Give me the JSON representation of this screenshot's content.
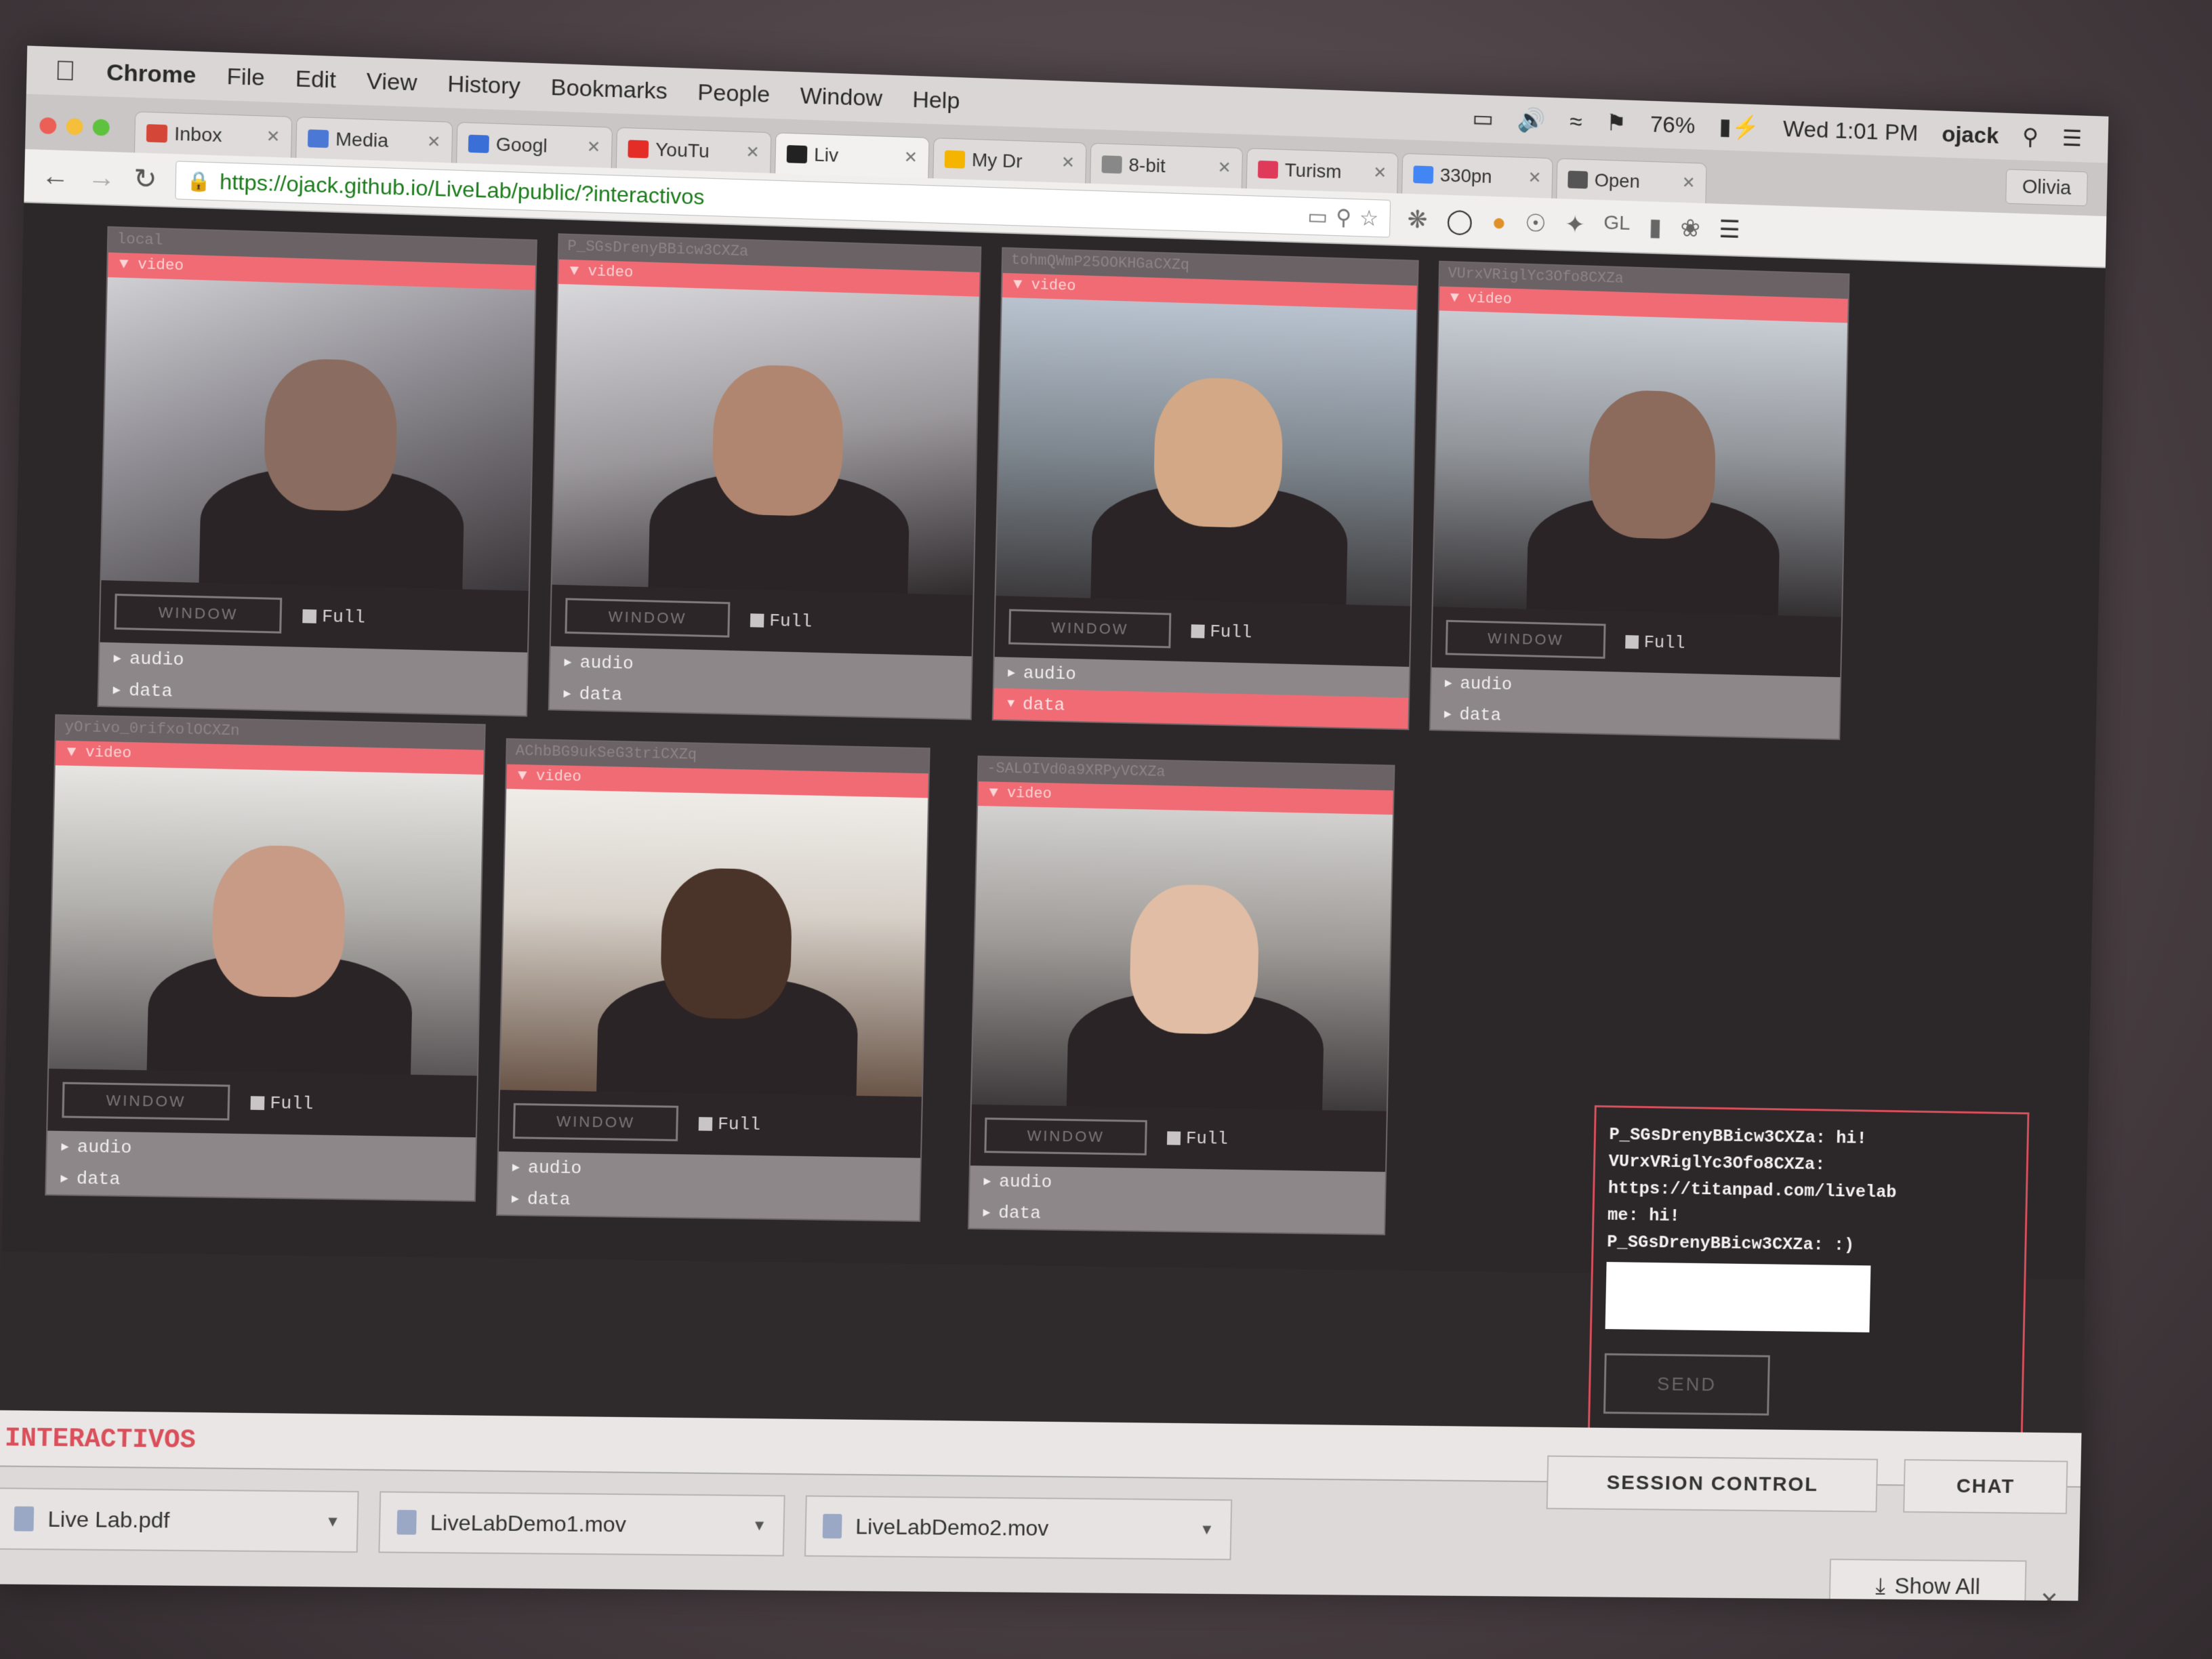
{
  "menubar": {
    "app": "Chrome",
    "items": [
      "File",
      "Edit",
      "View",
      "History",
      "Bookmarks",
      "People",
      "Window",
      "Help"
    ],
    "battery": "76%",
    "clock": "Wed 1:01 PM",
    "user": "ojack"
  },
  "tabs": [
    {
      "label": "Inbox",
      "color": "#d44638"
    },
    {
      "label": "Media",
      "color": "#4a78d4"
    },
    {
      "label": "Googl",
      "color": "#3a6fd8"
    },
    {
      "label": "YouTu",
      "color": "#e52d27"
    },
    {
      "label": "Liv",
      "color": "#222222",
      "active": true
    },
    {
      "label": "My Dr",
      "color": "#f4b400"
    },
    {
      "label": "8-bit",
      "color": "#888888"
    },
    {
      "label": "Turism",
      "color": "#e03a5a"
    },
    {
      "label": "330pn",
      "color": "#4285f4"
    },
    {
      "label": "Open",
      "color": "#555555"
    }
  ],
  "profile": "Olivia",
  "url": "https://ojack.github.io/LiveLab/public/?interactivos",
  "panels": [
    {
      "id": "local",
      "video_label": "video",
      "window_label": "WINDOW",
      "full_label": "Full",
      "audio_label": "audio",
      "data_label": "data"
    },
    {
      "id": "P_SGsDrenyBBicw3CXZa",
      "video_label": "video",
      "window_label": "WINDOW",
      "full_label": "Full",
      "audio_label": "audio",
      "data_label": "data"
    },
    {
      "id": "tohmQWmP25OOKHGaCXZq",
      "video_label": "video",
      "window_label": "WINDOW",
      "full_label": "Full",
      "audio_label": "audio",
      "data_label": "data",
      "data_open": true
    },
    {
      "id": "VUrxVRiglYc3Ofo8CXZa",
      "video_label": "video",
      "window_label": "WINDOW",
      "full_label": "Full",
      "audio_label": "audio",
      "data_label": "data"
    },
    {
      "id": "yOrivo_0rifxolOCXZn",
      "video_label": "video",
      "window_label": "WINDOW",
      "full_label": "Full",
      "audio_label": "audio",
      "data_label": "data"
    },
    {
      "id": "AChbBG9ukSeG3triCXZq",
      "video_label": "video",
      "window_label": "WINDOW",
      "full_label": "Full",
      "audio_label": "audio",
      "data_label": "data"
    },
    {
      "id": "-SALOIVd0a9XRPyVCXZa",
      "video_label": "video",
      "window_label": "WINDOW",
      "full_label": "Full",
      "audio_label": "audio",
      "data_label": "data"
    }
  ],
  "chat": {
    "messages": [
      "P_SGsDrenyBBicw3CXZa: hi!",
      "VUrxVRiglYc3Ofo8CXZa:",
      "https://titanpad.com/livelab",
      "me: hi!",
      "P_SGsDrenyBBicw3CXZa: :)"
    ],
    "send_label": "SEND"
  },
  "footer_title": "INTERACTIVOS",
  "downloads": [
    {
      "name": "Live Lab.pdf"
    },
    {
      "name": "LiveLabDemo1.mov"
    },
    {
      "name": "LiveLabDemo2.mov"
    }
  ],
  "session_control_label": "SESSION CONTROL",
  "chat_tab_label": "CHAT",
  "show_all_label": "Show All",
  "colors": {
    "accent": "#f06b74",
    "chat_border": "#d94f5b",
    "url": "#1a7a1a"
  }
}
